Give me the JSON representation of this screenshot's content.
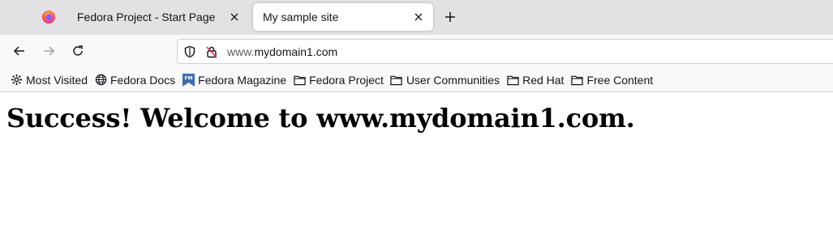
{
  "browser": {
    "tabs": [
      {
        "title": "Fedora Project - Start Page",
        "active": false
      },
      {
        "title": "My sample site",
        "active": true
      }
    ],
    "url": {
      "prefix": "www.",
      "domain": "mydomain1.com"
    },
    "bookmarks": [
      {
        "label": "Most Visited",
        "icon": "gear-icon"
      },
      {
        "label": "Fedora Docs",
        "icon": "globe-icon"
      },
      {
        "label": "Fedora Magazine",
        "icon": "fedora-magazine-icon"
      },
      {
        "label": "Fedora Project",
        "icon": "folder-icon"
      },
      {
        "label": "User Communities",
        "icon": "folder-icon"
      },
      {
        "label": "Red Hat",
        "icon": "folder-icon"
      },
      {
        "label": "Free Content",
        "icon": "folder-icon"
      }
    ],
    "colors": {
      "tabstrip": "#e2e1e3",
      "toolbar": "#f9f9fb",
      "firefox_orange": "#ff7139",
      "firefox_purple": "#9059ff",
      "magazine_blue": "#3c6eb4"
    }
  },
  "page": {
    "heading": "Success! Welcome to www.mydomain1.com."
  }
}
